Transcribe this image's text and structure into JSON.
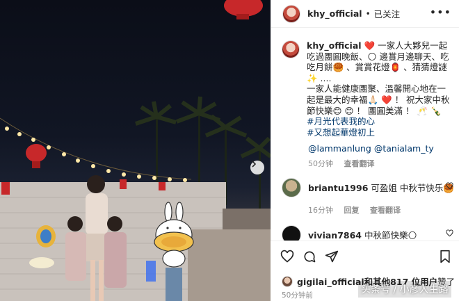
{
  "post": {
    "author": "khy_official",
    "separator": "•",
    "follow_state": "已关注",
    "more": "•••",
    "caption_parts": [
      "一家人大夥兒一起吃過團圓晚飯、🌕 邊賞月邊聊天、吃吃月餅🥮 、賞賞花燈🏮 、猜猜燈謎 ✨ ....",
      "一家人能健康團聚、溫馨開心地在一起是最大的幸福🙏🏻 ❤️ ！ 祝大家中秋節快樂😊 😊 ！ 團圓美滿 ！ 🥂 🍾"
    ],
    "caption_heart": "❤️",
    "hashtags": [
      "#月光代表我的心",
      "#又想起華燈初上"
    ],
    "mentions": [
      "@lammanlung",
      "@tanialam_ty"
    ],
    "caption_time": "50分钟",
    "see_translation": "查看翻译"
  },
  "comments": [
    {
      "user": "briantu1996",
      "text": "可盈姐 中秋节快乐🥮",
      "time": "16分钟",
      "reply": "回复",
      "see_translation": "查看翻译"
    },
    {
      "user": "vivian7864",
      "text": "中秋節快樂🌕"
    }
  ],
  "likes": {
    "user": "gigilai_official",
    "rest": "和其他817 位用户",
    "suffix": "赞了"
  },
  "posted_ago": "50分钟前",
  "watermark": "头条号 / 小彦人生路",
  "colors": {
    "link": "#00376b",
    "muted": "#8e8e8e",
    "border": "#efefef"
  }
}
